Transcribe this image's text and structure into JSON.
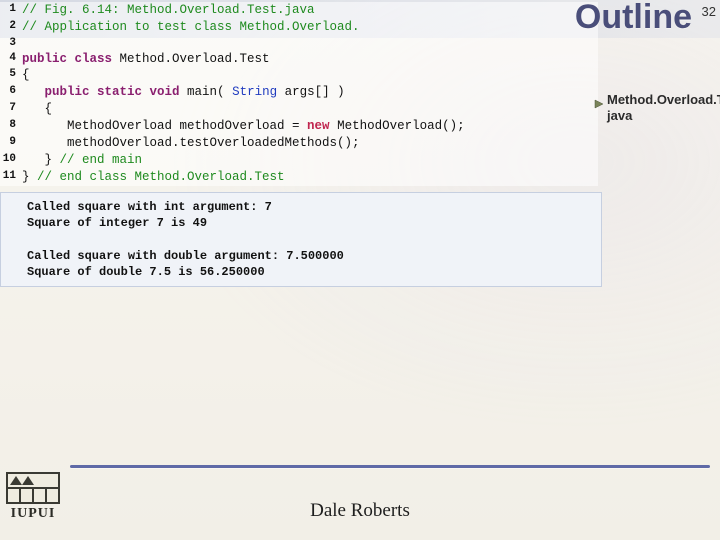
{
  "title": "Outline",
  "page_number": "32",
  "side_note": "Method.Overload.Test. java",
  "code": {
    "lines": [
      {
        "n": "1",
        "segs": [
          [
            "c-comment",
            "// Fig. 6.14: Method.Overload.Test.java"
          ]
        ]
      },
      {
        "n": "2",
        "segs": [
          [
            "c-comment",
            "// Application to test class Method.Overload."
          ]
        ]
      },
      {
        "n": "3",
        "segs": [
          [
            "c-plain",
            ""
          ]
        ]
      },
      {
        "n": "4",
        "segs": [
          [
            "c-key",
            "public class"
          ],
          [
            "c-plain",
            " Method.Overload.Test"
          ]
        ]
      },
      {
        "n": "5",
        "segs": [
          [
            "c-plain",
            "{"
          ]
        ]
      },
      {
        "n": "6",
        "segs": [
          [
            "c-plain",
            "   "
          ],
          [
            "c-key",
            "public static void"
          ],
          [
            "c-plain",
            " main( "
          ],
          [
            "c-type",
            "String"
          ],
          [
            "c-plain",
            " args[] )"
          ]
        ]
      },
      {
        "n": "7",
        "segs": [
          [
            "c-plain",
            "   {"
          ]
        ]
      },
      {
        "n": "8",
        "segs": [
          [
            "c-plain",
            "      MethodOverload methodOverload = "
          ],
          [
            "c-new",
            "new"
          ],
          [
            "c-plain",
            " MethodOverload();"
          ]
        ]
      },
      {
        "n": "9",
        "segs": [
          [
            "c-plain",
            "      methodOverload.testOverloadedMethods();"
          ]
        ]
      },
      {
        "n": "10",
        "segs": [
          [
            "c-plain",
            "   } "
          ],
          [
            "c-comment",
            "// end main"
          ]
        ]
      },
      {
        "n": "11",
        "segs": [
          [
            "c-plain",
            "} "
          ],
          [
            "c-comment",
            "// end class Method.Overload.Test"
          ]
        ]
      }
    ]
  },
  "output": "Called square with int argument: 7\nSquare of integer 7 is 49\n\nCalled square with double argument: 7.500000\nSquare of double 7.5 is 56.250000",
  "logo_text": "IUPUI",
  "author": "Dale Roberts"
}
